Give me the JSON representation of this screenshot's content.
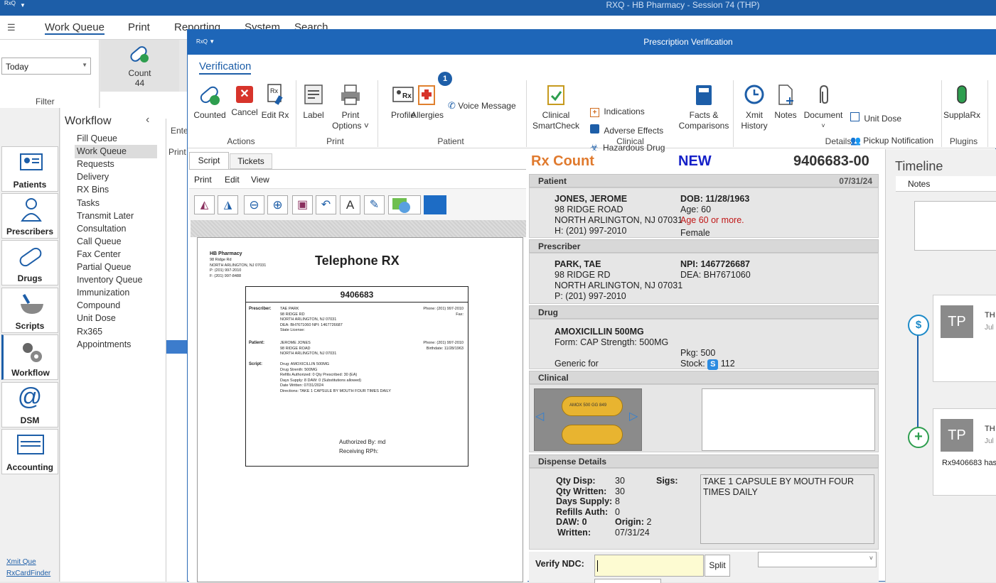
{
  "main": {
    "title": "RXQ - HB Pharmacy - Session 74 (THP)",
    "logo": "RxQ",
    "menu": [
      "Work Queue",
      "Print",
      "Reporting",
      "System",
      "Search"
    ],
    "filter": {
      "value": "Today",
      "label": "Filter"
    },
    "count": {
      "label": "Count",
      "value": "44"
    },
    "nav": [
      "Patients",
      "Prescribers",
      "Drugs",
      "Scripts",
      "Workflow",
      "DSM",
      "Accounting"
    ],
    "workflow_title": "Workflow",
    "workflow_items": [
      "Fill Queue",
      "Work Queue",
      "Requests",
      "Delivery",
      "RX Bins",
      "Tasks",
      "Transmit Later",
      "Consultation",
      "Call Queue",
      "Fax Center",
      "Partial Queue",
      "Inventory Queue",
      "Immunization",
      "Compound",
      "Unit Dose",
      "Rx365",
      "Appointments"
    ],
    "bottom_links": [
      "Xmit Que",
      "RxCardFinder"
    ],
    "partial_labels": [
      "Ente",
      "Print"
    ]
  },
  "child": {
    "title": "Prescription Verification",
    "tab": "Verification",
    "groups": {
      "actions": {
        "label": "Actions",
        "buttons": [
          "Counted",
          "Cancel",
          "Edit Rx"
        ]
      },
      "print": {
        "label": "Print",
        "buttons": [
          "Label",
          "Print",
          "Options"
        ]
      },
      "patient": {
        "label": "Patient",
        "buttons": [
          "Profile",
          "Allergies",
          "Voice Message"
        ],
        "allergy_badge": "1"
      },
      "clinical": {
        "label": "Clinical",
        "smartcheck1": "Clinical",
        "smartcheck2": "SmartCheck",
        "items": [
          "Indications",
          "Adverse Effects",
          "Hazardous Drug"
        ],
        "facts1": "Facts &",
        "facts2": "Comparisons"
      },
      "details": {
        "label": "Details",
        "xmit1": "Xmit",
        "xmit2": "History",
        "notes": "Notes",
        "document": "Document",
        "unit_dose": "Unit Dose",
        "pickup": "Pickup Notification"
      },
      "plugins": {
        "label": "Plugins",
        "button": "SupplaRx"
      }
    }
  },
  "script_panel": {
    "tabs": [
      "Script",
      "Tickets"
    ],
    "menu": [
      "Print",
      "Edit",
      "View"
    ],
    "document": {
      "pharmacy": "HB Pharmacy",
      "pharmacy_lines": [
        "98 Ridge Rd",
        "NORTH ARLINGTON, NJ 07031",
        "P: (201) 997-2010",
        "F: (201) 997-8488"
      ],
      "heading": "Telephone RX",
      "rx_number": "9406683",
      "prescriber_label": "Prescriber:",
      "prescriber_lines": [
        "TAE PARK",
        "98 RIDGE RD",
        "NORTH ARLINGTON, NJ 07031",
        "DEA: BH7671060   NPI: 1467726687",
        "State License:"
      ],
      "prescriber_phone": "Phone: (201) 997-2010",
      "prescriber_fax": "Fax:",
      "patient_label": "Patient:",
      "patient_lines": [
        "JEROME JONES",
        "98 RIDGE ROAD",
        "NORTH ARLINGTON, NJ 07031"
      ],
      "patient_phone": "Phone: (201) 997-2010",
      "patient_birth": "Birthdate: 11/28/1963",
      "script_label": "Script:",
      "script_lines": [
        "Drug: AMOXICILLIN  500MG",
        "Drug Strenth: 500MG",
        "Refills Authorized: 0 Qty Prescribed: 30 (EA)",
        "Days Supply: 8   DAW: 0 (Substitutions allowed)",
        "Date Written: 07/31/2024",
        "Directions: TAKE 1 CAPSULE BY MOUTH FOUR TIMES DAILY"
      ],
      "authorized": "Authorized By: md",
      "receiving": "Receiving RPh:"
    }
  },
  "rx": {
    "count_label": "Rx Count",
    "status": "NEW",
    "number": "9406683-00",
    "date": "07/31/24",
    "patient": {
      "section": "Patient",
      "name": "JONES, JEROME",
      "address1": "98 RIDGE ROAD",
      "address2": "NORTH ARLINGTON, NJ 07031",
      "phone": "H: (201) 997-2010",
      "dob": "DOB: 11/28/1963",
      "age": "Age: 60",
      "age_warning": "Age 60 or more.",
      "gender": "Female"
    },
    "prescriber": {
      "section": "Prescriber",
      "name": "PARK, TAE",
      "address1": "98 RIDGE RD",
      "address2": "NORTH ARLINGTON, NJ 07031",
      "phone": "P: (201) 997-2010",
      "npi": "NPI: 1467726687",
      "dea": "DEA: BH7671060"
    },
    "drug": {
      "section": "Drug",
      "name": "AMOXICILLIN  500MG",
      "form": "Form: CAP   Strength: 500MG",
      "generic": "Generic for",
      "pkg": "Pkg: 500",
      "stock_label": "Stock:",
      "stock_badge": "S",
      "stock": "112"
    },
    "clinical": {
      "section": "Clinical",
      "imprint": "AMOX 500   GG 849"
    },
    "dispense": {
      "section": "Dispense Details",
      "labels": [
        "Qty Disp:",
        "Qty Written:",
        "Days Supply:",
        "Refills Auth:"
      ],
      "values": [
        "30",
        "30",
        "8",
        "0"
      ],
      "daw": "DAW:  0",
      "origin_label": "Origin:",
      "origin": "2",
      "written_label": "Written:",
      "written": "07/31/24",
      "sigs_label": "Sigs:",
      "sigs": "TAKE 1 CAPSULE BY MOUTH FOUR TIMES DAILY"
    },
    "verify_label": "Verify NDC:",
    "split": "Split"
  },
  "timeline": {
    "title": "Timeline",
    "tab": "Notes",
    "entries": [
      {
        "initials": "TP",
        "head": "TH",
        "sub": "Jul"
      },
      {
        "initials": "TP",
        "head": "TH",
        "sub": "Jul",
        "text": "Rx9406683 has"
      }
    ]
  }
}
